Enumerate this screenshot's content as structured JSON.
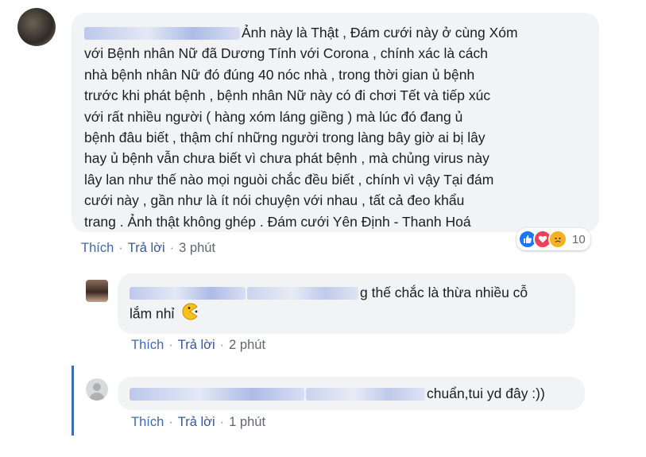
{
  "comments": [
    {
      "author_label": "Nguyễn Văn Dương",
      "text_lines": [
        "Ảnh này là Thật , Đám cưới này ở cùng Xóm",
        "với Bệnh nhân Nữ đã Dương Tính với Corona , chính xác là cách",
        "nhà bệnh nhân Nữ đó đúng 40 nóc nhà , trong thời gian ủ bệnh",
        "trước khi phát bệnh , bệnh nhân Nữ này có đi chơi Tết và tiếp xúc",
        "với rất nhiều người ( hàng xóm láng giềng ) mà lúc đó đang ủ",
        "bệnh đâu biết , thậm chí những người trong làng bây giờ ai bị lây",
        "hay ủ bệnh vẫn chưa biết vì chưa phát bệnh , mà chủng virus này",
        "lây lan như thế nào mọi nguòi chắc đều biết , chính vì vậy Tại đám",
        "cưới này , gần như là ít nói chuyện với nhau , tất cả đeo khẩu",
        "trang . Ảnh thật không ghép . Đám cưới Yên Định - Thanh Hoá"
      ],
      "like_label": "Thích",
      "reply_label": "Trả lời",
      "time": "3 phút",
      "reaction_count": "10",
      "reaction_icons": [
        "like-icon",
        "love-icon",
        "sad-icon"
      ]
    },
    {
      "author_label": "Mỹ Khánh Nguyễn",
      "text_line1": "g thế chắc là thừa nhiều cỗ",
      "text_line2": "lắm nhỉ",
      "emoji": "pacman-emoji",
      "like_label": "Thích",
      "reply_label": "Trả lời",
      "time": "2 phút"
    },
    {
      "author_label": "Nguyễn Ngọc Anh",
      "text": "chuẩn,tui yd đây :))",
      "like_label": "Thích",
      "reply_label": "Trả lời",
      "time": "1 phút"
    }
  ],
  "colors": {
    "link": "#4267b2",
    "bubble": "#f2f3f5",
    "like": "#1877f2",
    "love": "#f33e58",
    "sad": "#f7b125"
  }
}
